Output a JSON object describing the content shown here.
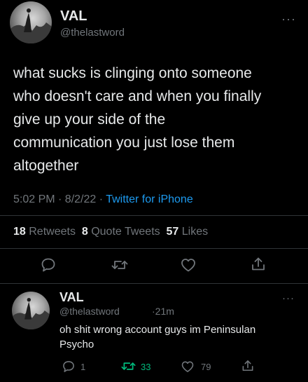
{
  "main_tweet": {
    "author_name": "VAL",
    "author_handle": "@thelastword",
    "more": "···",
    "text_lines": [
      "what sucks is clinging onto someone",
      "who doesn't care and when you finally",
      "give up your side of the",
      "communication you just lose them",
      "altogether"
    ],
    "time": "5:02 PM · 8/2/22 · ",
    "source": "Twitter for iPhone",
    "stats": {
      "retweets_count": "18",
      "retweets_label": "Retweets",
      "quotes_count": "8",
      "quotes_label": "Quote Tweets",
      "likes_count": "57",
      "likes_label": "Likes"
    }
  },
  "reply_tweet": {
    "author_name": "VAL",
    "author_handle": "@thelastword",
    "age": "·21m",
    "more": "···",
    "text_line1": "oh shit wrong account guys  im  Peninsulan",
    "text_line2": "Psycho",
    "reply_count": "1",
    "retweet_count": "33",
    "like_count": "79"
  },
  "colors": {
    "background": "#000000",
    "text": "#e7e9ea",
    "muted": "#71767b",
    "link": "#1d9bf0",
    "retweet_active": "#00ba7c"
  },
  "icons": [
    "reply-icon",
    "retweet-icon",
    "like-icon",
    "share-icon",
    "more-icon"
  ]
}
